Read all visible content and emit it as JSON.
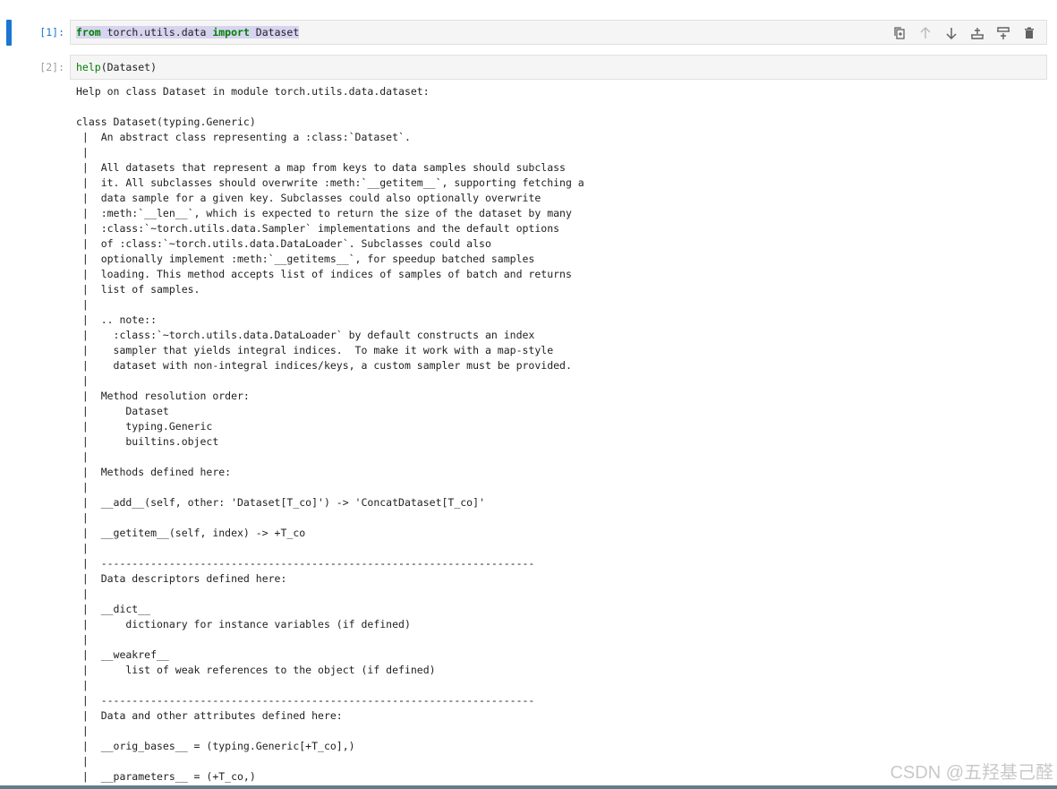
{
  "cells": [
    {
      "prompt": "[1]:",
      "code": {
        "kw1": "from",
        "module": " torch.utils.data ",
        "kw2": "import",
        "name": " Dataset"
      }
    },
    {
      "prompt": "[2]:",
      "code": {
        "fn": "help",
        "args": "(Dataset)"
      }
    }
  ],
  "output_text": "Help on class Dataset in module torch.utils.data.dataset:\n\nclass Dataset(typing.Generic)\n |  An abstract class representing a :class:`Dataset`.\n |\n |  All datasets that represent a map from keys to data samples should subclass\n |  it. All subclasses should overwrite :meth:`__getitem__`, supporting fetching a\n |  data sample for a given key. Subclasses could also optionally overwrite\n |  :meth:`__len__`, which is expected to return the size of the dataset by many\n |  :class:`~torch.utils.data.Sampler` implementations and the default options\n |  of :class:`~torch.utils.data.DataLoader`. Subclasses could also\n |  optionally implement :meth:`__getitems__`, for speedup batched samples\n |  loading. This method accepts list of indices of samples of batch and returns\n |  list of samples.\n |\n |  .. note::\n |    :class:`~torch.utils.data.DataLoader` by default constructs an index\n |    sampler that yields integral indices.  To make it work with a map-style\n |    dataset with non-integral indices/keys, a custom sampler must be provided.\n |\n |  Method resolution order:\n |      Dataset\n |      typing.Generic\n |      builtins.object\n |\n |  Methods defined here:\n |\n |  __add__(self, other: 'Dataset[T_co]') -> 'ConcatDataset[T_co]'\n |\n |  __getitem__(self, index) -> +T_co\n |\n |  ----------------------------------------------------------------------\n |  Data descriptors defined here:\n |\n |  __dict__\n |      dictionary for instance variables (if defined)\n |\n |  __weakref__\n |      list of weak references to the object (if defined)\n |\n |  ----------------------------------------------------------------------\n |  Data and other attributes defined here:\n |\n |  __orig_bases__ = (typing.Generic[+T_co],)\n |\n |  __parameters__ = (+T_co,)",
  "watermark": "CSDN @五羟基己醛",
  "icons": [
    "duplicate-icon",
    "move-up-icon",
    "move-down-icon",
    "insert-above-icon",
    "insert-below-icon",
    "delete-icon"
  ],
  "colors": {
    "accent": "#1976d2",
    "keyword": "#008000",
    "cell_bg": "#f5f5f5"
  }
}
